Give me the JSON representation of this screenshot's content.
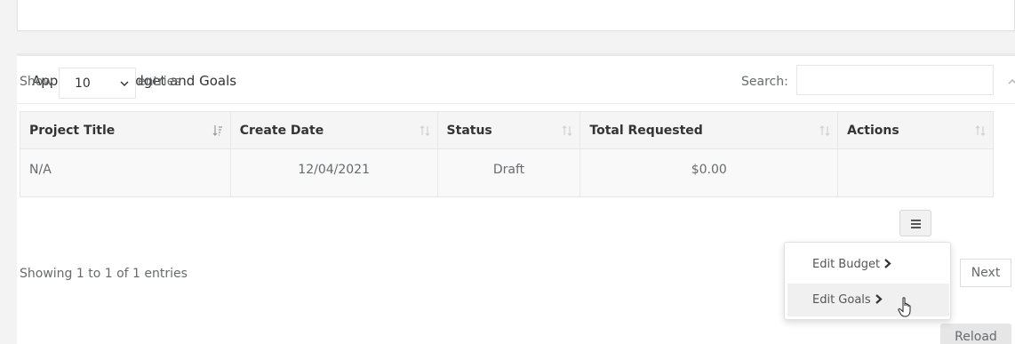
{
  "panel": {
    "title": "Applications Budget and Goals"
  },
  "table_controls": {
    "show_label": "Show",
    "length_value": "10",
    "entries_label": "entries",
    "search_label": "Search:",
    "search_value": ""
  },
  "table": {
    "columns": [
      "Project Title",
      "Create Date",
      "Status",
      "Total Requested",
      "Actions"
    ],
    "rows": [
      {
        "project_title": "N/A",
        "create_date": "12/04/2021",
        "status": "Draft",
        "total_requested": "$0.00"
      }
    ]
  },
  "footer": {
    "info": "Showing 1 to 1 of 1 entries",
    "next_label": "Next",
    "reload_label": "Reload"
  },
  "actions_menu": {
    "items": [
      "Edit Budget",
      "Edit Goals"
    ]
  },
  "icons": {
    "collapse": "chevron-up-icon",
    "sort_active": "sort-asc-icon",
    "sort": "sort-icon",
    "menu": "hamburger-icon",
    "cursor": "hand-pointer-icon"
  }
}
